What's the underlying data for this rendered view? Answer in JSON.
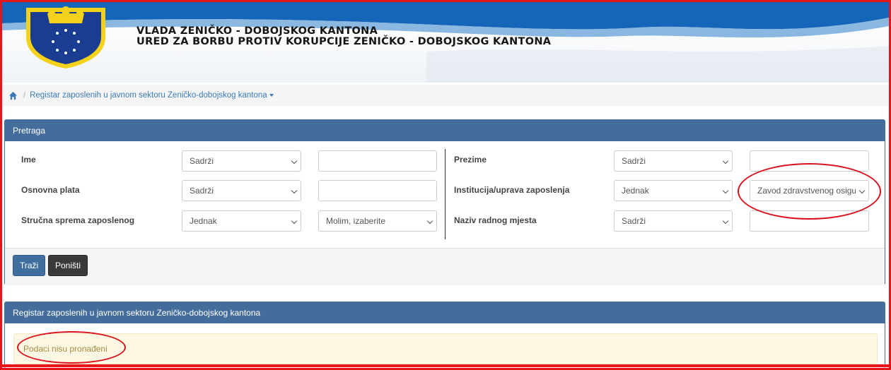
{
  "header": {
    "line1": "VLADA ZENIČKO - DOBOJSKOG KANTONA",
    "line2": "URED ZA BORBU PROTIV KORUPCIJE ZENIČKO - DOBOJSKOG KANTONA"
  },
  "breadcrumb": {
    "home_icon": "home-icon",
    "separator": "/",
    "link": "Registar zaposlenih u javnom sektoru Zeničko-dobojskog kantona"
  },
  "search_panel": {
    "title": "Pretraga",
    "fields": [
      {
        "label": "Ime",
        "operator": "Sadrži",
        "value": ""
      },
      {
        "label": "Osnovna plata",
        "operator": "Sadrži",
        "value": ""
      },
      {
        "label": "Stručna sprema zaposlenog",
        "operator": "Jednak",
        "value": "Molim, izaberite"
      },
      {
        "label": "Prezime",
        "operator": "Sadrži",
        "value": ""
      },
      {
        "label": "Institucija/uprava zaposlenja",
        "operator": "Jednak",
        "value": "Zavod zdravstvenog osiguranja"
      },
      {
        "label": "Naziv radnog mjesta",
        "operator": "Sadrži",
        "value": ""
      }
    ],
    "buttons": {
      "search": "Traži",
      "reset": "Poništi"
    }
  },
  "results_panel": {
    "title": "Registar zaposlenih u javnom sektoru Zeničko-dobojskog kantona",
    "empty_message": "Podaci nisu pronađeni"
  },
  "colors": {
    "panel_header": "#456d9b",
    "annotation": "#d9101a",
    "border": "#e8141b"
  }
}
